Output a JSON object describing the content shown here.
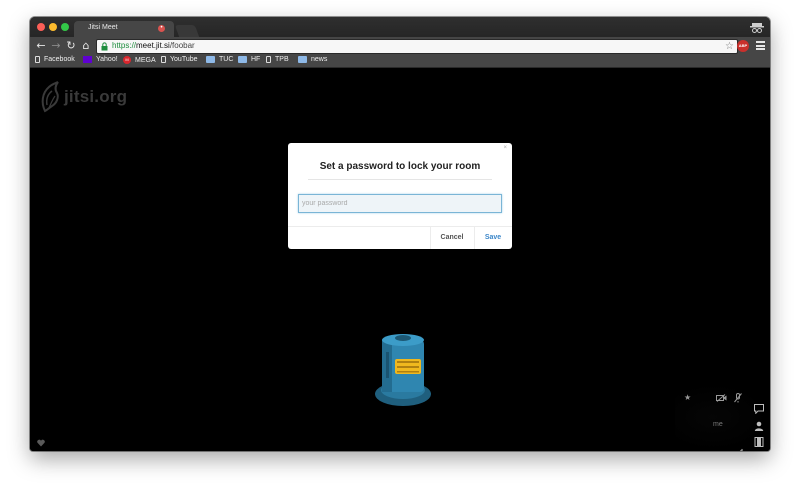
{
  "browser": {
    "tab_title": "Jitsi Meet",
    "url_scheme": "https://",
    "url_domain": "meet.jit.si",
    "url_path": "/foobar",
    "abp_label": "ABP"
  },
  "bookmarks": [
    {
      "label": "Facebook",
      "icon": "page-icon"
    },
    {
      "label": "Yahoo!",
      "icon": "yahoo-icon"
    },
    {
      "label": "MEGA",
      "icon": "mega-icon",
      "badge": "M"
    },
    {
      "label": "YouTube",
      "icon": "page-icon"
    },
    {
      "label": "TUC",
      "icon": "folder-icon"
    },
    {
      "label": "HF",
      "icon": "folder-icon"
    },
    {
      "label": "TPB",
      "icon": "page-icon"
    },
    {
      "label": "news",
      "icon": "folder-icon"
    }
  ],
  "page": {
    "logo_text": "jitsi.org",
    "local_video_label": "me"
  },
  "dialog": {
    "close_glyph": "×",
    "title": "Set a password to lock your room",
    "password_placeholder": "your password",
    "cancel_label": "Cancel",
    "save_label": "Save"
  },
  "colors": {
    "accent": "#3b86c9",
    "page_background": "#000000",
    "chrome_toolbar": "#464646"
  }
}
